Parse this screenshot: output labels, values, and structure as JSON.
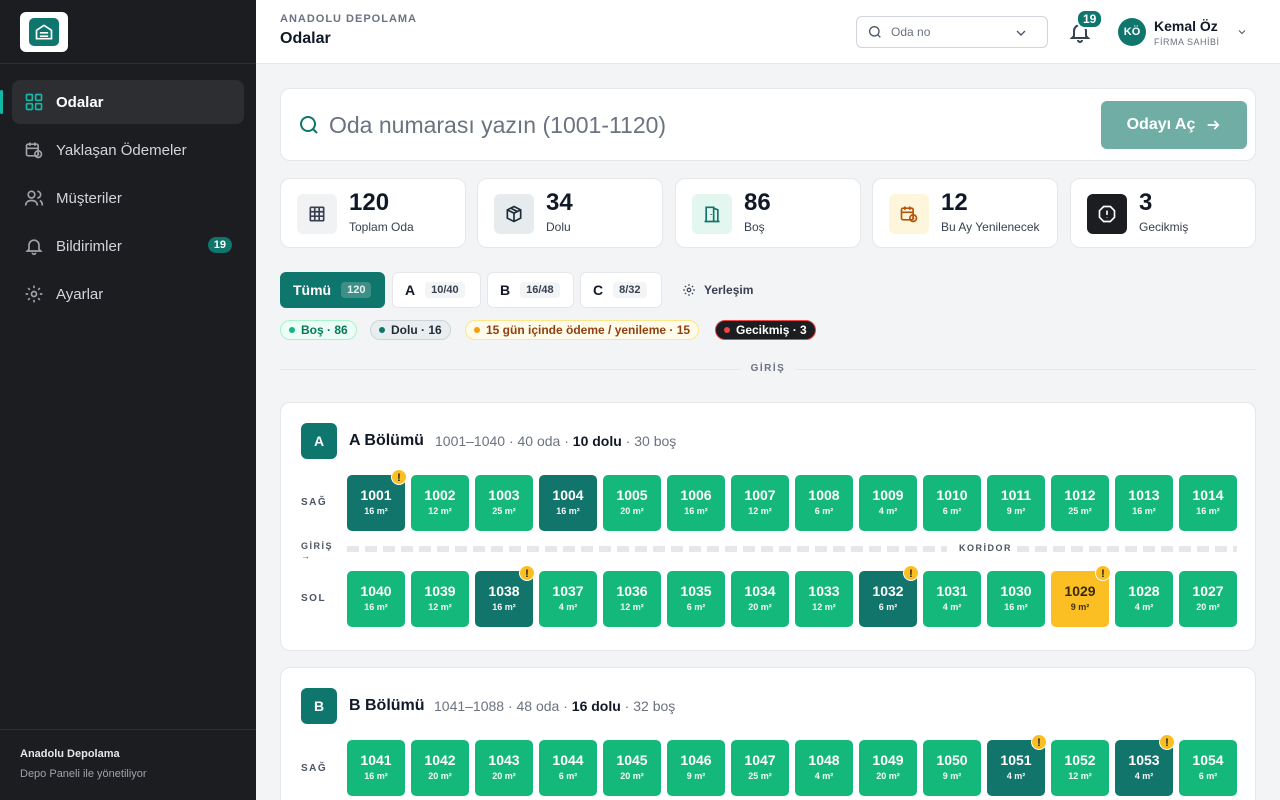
{
  "sidebar": {
    "items": [
      {
        "label": "Odalar",
        "icon": "grid-icon",
        "active": true
      },
      {
        "label": "Yaklaşan Ödemeler",
        "icon": "calendar-clock-icon"
      },
      {
        "label": "Müşteriler",
        "icon": "users-icon"
      },
      {
        "label": "Bildirimler",
        "icon": "bell-icon",
        "badge": "19"
      },
      {
        "label": "Ayarlar",
        "icon": "gear-icon"
      }
    ],
    "footer_title": "Anadolu Depolama",
    "footer_sub": "Depo Paneli ile yönetiliyor"
  },
  "header": {
    "brand": "ANADOLU DEPOLAMA",
    "title": "Odalar",
    "search_placeholder": "Oda no",
    "notif_count": "19",
    "user_initials": "KÖ",
    "user_name": "Kemal Öz",
    "user_role": "FİRMA SAHİBİ"
  },
  "search": {
    "placeholder": "Oda numarası yazın (1001-1120)",
    "button": "Odayı Aç"
  },
  "stats": [
    {
      "value": "120",
      "label": "Toplam Oda",
      "icon": "grid-icon"
    },
    {
      "value": "34",
      "label": "Dolu",
      "icon": "box-icon"
    },
    {
      "value": "86",
      "label": "Boş",
      "icon": "door-icon"
    },
    {
      "value": "12",
      "label": "Bu Ay Yenilenecek",
      "icon": "calendar-clock-icon"
    },
    {
      "value": "3",
      "label": "Gecikmiş",
      "icon": "alert-icon"
    }
  ],
  "tabs": [
    {
      "label": "Tümü",
      "count": "120",
      "active": true
    },
    {
      "label": "A",
      "count": "10/40"
    },
    {
      "label": "B",
      "count": "16/48"
    },
    {
      "label": "C",
      "count": "8/32"
    },
    {
      "label": "Yerleşim"
    }
  ],
  "legend": [
    {
      "label": "Boş · 86"
    },
    {
      "label": "Dolu · 16"
    },
    {
      "label": "15 gün içinde ödeme / yenileme · 15"
    },
    {
      "label": "Gecikmiş · 3"
    }
  ],
  "entrance_label": "GİRİŞ",
  "labels": {
    "sag": "SAĞ",
    "sol": "SOL",
    "giris": "GİRİŞ →",
    "koridor": "KORİDOR"
  },
  "sectionA": {
    "letter": "A",
    "title": "A Bölümü",
    "range": "1001–1040 · 40 oda · ",
    "dolu": "10 dolu",
    "bos": " · 30 boş",
    "right": [
      {
        "n": "1001",
        "s": "16 m²",
        "st": "dolu",
        "w": true
      },
      {
        "n": "1002",
        "s": "12 m²",
        "st": "bos"
      },
      {
        "n": "1003",
        "s": "25 m²",
        "st": "bos"
      },
      {
        "n": "1004",
        "s": "16 m²",
        "st": "dolu"
      },
      {
        "n": "1005",
        "s": "20 m²",
        "st": "bos"
      },
      {
        "n": "1006",
        "s": "16 m²",
        "st": "bos"
      },
      {
        "n": "1007",
        "s": "12 m²",
        "st": "bos"
      },
      {
        "n": "1008",
        "s": "6 m²",
        "st": "bos"
      },
      {
        "n": "1009",
        "s": "4 m²",
        "st": "bos"
      },
      {
        "n": "1010",
        "s": "6 m²",
        "st": "bos"
      },
      {
        "n": "1011",
        "s": "9 m²",
        "st": "bos"
      },
      {
        "n": "1012",
        "s": "25 m²",
        "st": "bos"
      },
      {
        "n": "1013",
        "s": "16 m²",
        "st": "bos"
      },
      {
        "n": "1014",
        "s": "16 m²",
        "st": "bos"
      }
    ],
    "left": [
      {
        "n": "1040",
        "s": "16 m²",
        "st": "bos"
      },
      {
        "n": "1039",
        "s": "12 m²",
        "st": "bos"
      },
      {
        "n": "1038",
        "s": "16 m²",
        "st": "dolu",
        "w": true
      },
      {
        "n": "1037",
        "s": "4 m²",
        "st": "bos"
      },
      {
        "n": "1036",
        "s": "12 m²",
        "st": "bos"
      },
      {
        "n": "1035",
        "s": "6 m²",
        "st": "bos"
      },
      {
        "n": "1034",
        "s": "20 m²",
        "st": "bos"
      },
      {
        "n": "1033",
        "s": "12 m²",
        "st": "bos"
      },
      {
        "n": "1032",
        "s": "6 m²",
        "st": "dolu",
        "w": true
      },
      {
        "n": "1031",
        "s": "4 m²",
        "st": "bos"
      },
      {
        "n": "1030",
        "s": "16 m²",
        "st": "bos"
      },
      {
        "n": "1029",
        "s": "9 m²",
        "st": "yakin",
        "w": true
      },
      {
        "n": "1028",
        "s": "4 m²",
        "st": "bos"
      },
      {
        "n": "1027",
        "s": "20 m²",
        "st": "bos"
      }
    ]
  },
  "sectionB": {
    "letter": "B",
    "title": "B Bölümü",
    "range": "1041–1088 · 48 oda · ",
    "dolu": "16 dolu",
    "bos": " · 32 boş",
    "right": [
      {
        "n": "1041",
        "s": "16 m²",
        "st": "bos"
      },
      {
        "n": "1042",
        "s": "20 m²",
        "st": "bos"
      },
      {
        "n": "1043",
        "s": "20 m²",
        "st": "bos"
      },
      {
        "n": "1044",
        "s": "6 m²",
        "st": "bos"
      },
      {
        "n": "1045",
        "s": "20 m²",
        "st": "bos"
      },
      {
        "n": "1046",
        "s": "9 m²",
        "st": "bos"
      },
      {
        "n": "1047",
        "s": "25 m²",
        "st": "bos"
      },
      {
        "n": "1048",
        "s": "4 m²",
        "st": "bos"
      },
      {
        "n": "1049",
        "s": "20 m²",
        "st": "bos"
      },
      {
        "n": "1050",
        "s": "9 m²",
        "st": "bos"
      },
      {
        "n": "1051",
        "s": "4 m²",
        "st": "dolu",
        "w": true
      },
      {
        "n": "1052",
        "s": "12 m²",
        "st": "bos"
      },
      {
        "n": "1053",
        "s": "4 m²",
        "st": "dolu",
        "w": true
      },
      {
        "n": "1054",
        "s": "6 m²",
        "st": "bos"
      }
    ]
  },
  "colors": {
    "accent": "#0f766e",
    "bos": "#14b87a",
    "dolu": "#12756b",
    "yakin": "#fbbf24",
    "gecikmis": "#1f1f1f"
  }
}
